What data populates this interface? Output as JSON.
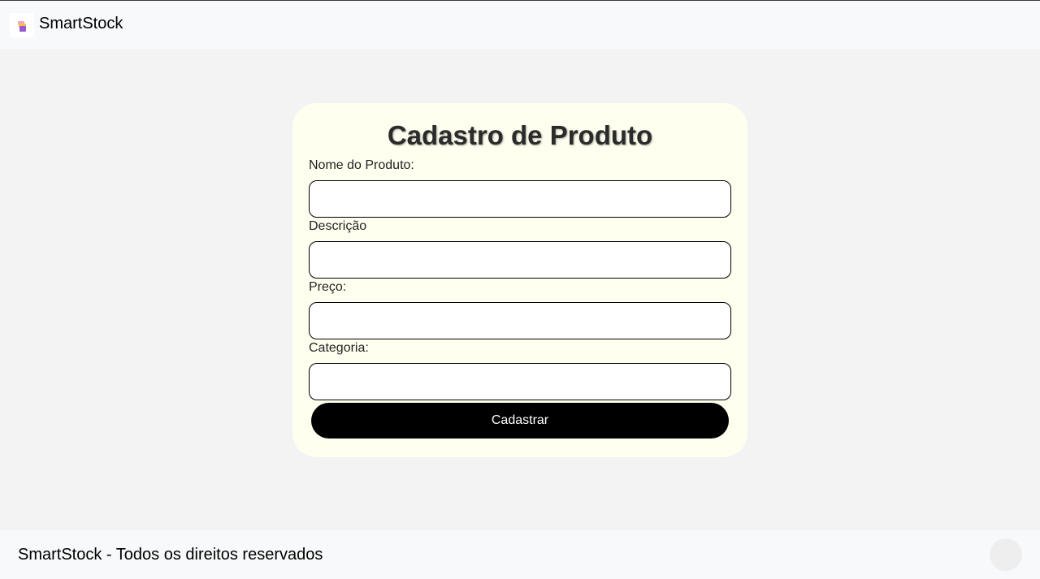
{
  "header": {
    "brand": "SmartStock",
    "logo_icon": "stacked-boxes-icon"
  },
  "form": {
    "title": "Cadastro de Produto",
    "fields": [
      {
        "label": "Nome do Produto:",
        "value": "",
        "placeholder": ""
      },
      {
        "label": "Descrição",
        "value": "",
        "placeholder": ""
      },
      {
        "label": "Preço:",
        "value": "",
        "placeholder": ""
      },
      {
        "label": "Categoria:",
        "value": "",
        "placeholder": ""
      }
    ],
    "submit_label": "Cadastrar"
  },
  "footer": {
    "text": "SmartStock - Todos os direitos reservados"
  },
  "colors": {
    "card_background": "#fffff0",
    "page_background": "#f3f3f3",
    "bar_background": "#f8f9fa",
    "button_background": "#000000"
  }
}
